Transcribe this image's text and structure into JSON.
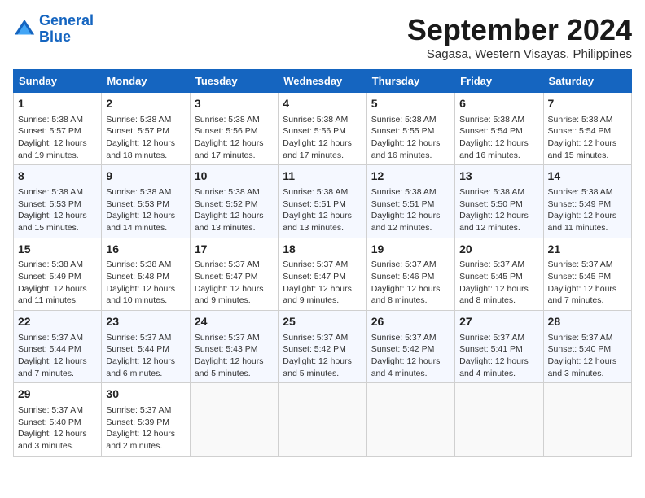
{
  "logo": {
    "line1": "General",
    "line2": "Blue"
  },
  "title": "September 2024",
  "location": "Sagasa, Western Visayas, Philippines",
  "weekdays": [
    "Sunday",
    "Monday",
    "Tuesday",
    "Wednesday",
    "Thursday",
    "Friday",
    "Saturday"
  ],
  "weeks": [
    [
      {
        "day": "1",
        "sunrise": "Sunrise: 5:38 AM",
        "sunset": "Sunset: 5:57 PM",
        "daylight": "Daylight: 12 hours and 19 minutes."
      },
      {
        "day": "2",
        "sunrise": "Sunrise: 5:38 AM",
        "sunset": "Sunset: 5:57 PM",
        "daylight": "Daylight: 12 hours and 18 minutes."
      },
      {
        "day": "3",
        "sunrise": "Sunrise: 5:38 AM",
        "sunset": "Sunset: 5:56 PM",
        "daylight": "Daylight: 12 hours and 17 minutes."
      },
      {
        "day": "4",
        "sunrise": "Sunrise: 5:38 AM",
        "sunset": "Sunset: 5:56 PM",
        "daylight": "Daylight: 12 hours and 17 minutes."
      },
      {
        "day": "5",
        "sunrise": "Sunrise: 5:38 AM",
        "sunset": "Sunset: 5:55 PM",
        "daylight": "Daylight: 12 hours and 16 minutes."
      },
      {
        "day": "6",
        "sunrise": "Sunrise: 5:38 AM",
        "sunset": "Sunset: 5:54 PM",
        "daylight": "Daylight: 12 hours and 16 minutes."
      },
      {
        "day": "7",
        "sunrise": "Sunrise: 5:38 AM",
        "sunset": "Sunset: 5:54 PM",
        "daylight": "Daylight: 12 hours and 15 minutes."
      }
    ],
    [
      {
        "day": "8",
        "sunrise": "Sunrise: 5:38 AM",
        "sunset": "Sunset: 5:53 PM",
        "daylight": "Daylight: 12 hours and 15 minutes."
      },
      {
        "day": "9",
        "sunrise": "Sunrise: 5:38 AM",
        "sunset": "Sunset: 5:53 PM",
        "daylight": "Daylight: 12 hours and 14 minutes."
      },
      {
        "day": "10",
        "sunrise": "Sunrise: 5:38 AM",
        "sunset": "Sunset: 5:52 PM",
        "daylight": "Daylight: 12 hours and 13 minutes."
      },
      {
        "day": "11",
        "sunrise": "Sunrise: 5:38 AM",
        "sunset": "Sunset: 5:51 PM",
        "daylight": "Daylight: 12 hours and 13 minutes."
      },
      {
        "day": "12",
        "sunrise": "Sunrise: 5:38 AM",
        "sunset": "Sunset: 5:51 PM",
        "daylight": "Daylight: 12 hours and 12 minutes."
      },
      {
        "day": "13",
        "sunrise": "Sunrise: 5:38 AM",
        "sunset": "Sunset: 5:50 PM",
        "daylight": "Daylight: 12 hours and 12 minutes."
      },
      {
        "day": "14",
        "sunrise": "Sunrise: 5:38 AM",
        "sunset": "Sunset: 5:49 PM",
        "daylight": "Daylight: 12 hours and 11 minutes."
      }
    ],
    [
      {
        "day": "15",
        "sunrise": "Sunrise: 5:38 AM",
        "sunset": "Sunset: 5:49 PM",
        "daylight": "Daylight: 12 hours and 11 minutes."
      },
      {
        "day": "16",
        "sunrise": "Sunrise: 5:38 AM",
        "sunset": "Sunset: 5:48 PM",
        "daylight": "Daylight: 12 hours and 10 minutes."
      },
      {
        "day": "17",
        "sunrise": "Sunrise: 5:37 AM",
        "sunset": "Sunset: 5:47 PM",
        "daylight": "Daylight: 12 hours and 9 minutes."
      },
      {
        "day": "18",
        "sunrise": "Sunrise: 5:37 AM",
        "sunset": "Sunset: 5:47 PM",
        "daylight": "Daylight: 12 hours and 9 minutes."
      },
      {
        "day": "19",
        "sunrise": "Sunrise: 5:37 AM",
        "sunset": "Sunset: 5:46 PM",
        "daylight": "Daylight: 12 hours and 8 minutes."
      },
      {
        "day": "20",
        "sunrise": "Sunrise: 5:37 AM",
        "sunset": "Sunset: 5:45 PM",
        "daylight": "Daylight: 12 hours and 8 minutes."
      },
      {
        "day": "21",
        "sunrise": "Sunrise: 5:37 AM",
        "sunset": "Sunset: 5:45 PM",
        "daylight": "Daylight: 12 hours and 7 minutes."
      }
    ],
    [
      {
        "day": "22",
        "sunrise": "Sunrise: 5:37 AM",
        "sunset": "Sunset: 5:44 PM",
        "daylight": "Daylight: 12 hours and 7 minutes."
      },
      {
        "day": "23",
        "sunrise": "Sunrise: 5:37 AM",
        "sunset": "Sunset: 5:44 PM",
        "daylight": "Daylight: 12 hours and 6 minutes."
      },
      {
        "day": "24",
        "sunrise": "Sunrise: 5:37 AM",
        "sunset": "Sunset: 5:43 PM",
        "daylight": "Daylight: 12 hours and 5 minutes."
      },
      {
        "day": "25",
        "sunrise": "Sunrise: 5:37 AM",
        "sunset": "Sunset: 5:42 PM",
        "daylight": "Daylight: 12 hours and 5 minutes."
      },
      {
        "day": "26",
        "sunrise": "Sunrise: 5:37 AM",
        "sunset": "Sunset: 5:42 PM",
        "daylight": "Daylight: 12 hours and 4 minutes."
      },
      {
        "day": "27",
        "sunrise": "Sunrise: 5:37 AM",
        "sunset": "Sunset: 5:41 PM",
        "daylight": "Daylight: 12 hours and 4 minutes."
      },
      {
        "day": "28",
        "sunrise": "Sunrise: 5:37 AM",
        "sunset": "Sunset: 5:40 PM",
        "daylight": "Daylight: 12 hours and 3 minutes."
      }
    ],
    [
      {
        "day": "29",
        "sunrise": "Sunrise: 5:37 AM",
        "sunset": "Sunset: 5:40 PM",
        "daylight": "Daylight: 12 hours and 3 minutes."
      },
      {
        "day": "30",
        "sunrise": "Sunrise: 5:37 AM",
        "sunset": "Sunset: 5:39 PM",
        "daylight": "Daylight: 12 hours and 2 minutes."
      },
      null,
      null,
      null,
      null,
      null
    ]
  ]
}
